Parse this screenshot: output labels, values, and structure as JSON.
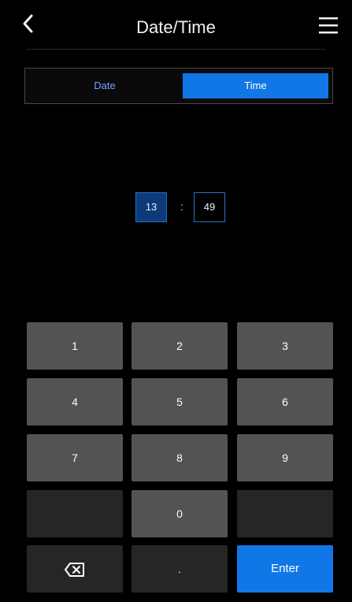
{
  "header": {
    "title": "Date/Time"
  },
  "tabs": {
    "date": "Date",
    "time": "Time"
  },
  "time": {
    "hour": "13",
    "separator": ":",
    "minute": "49"
  },
  "keypad": {
    "k1": "1",
    "k2": "2",
    "k3": "3",
    "k4": "4",
    "k5": "5",
    "k6": "6",
    "k7": "7",
    "k8": "8",
    "k9": "9",
    "k0": "0",
    "dot": ".",
    "enter": "Enter"
  },
  "colors": {
    "accent": "#1177e6",
    "key": "#535353",
    "key_dim": "#262626",
    "background": "#000000"
  }
}
